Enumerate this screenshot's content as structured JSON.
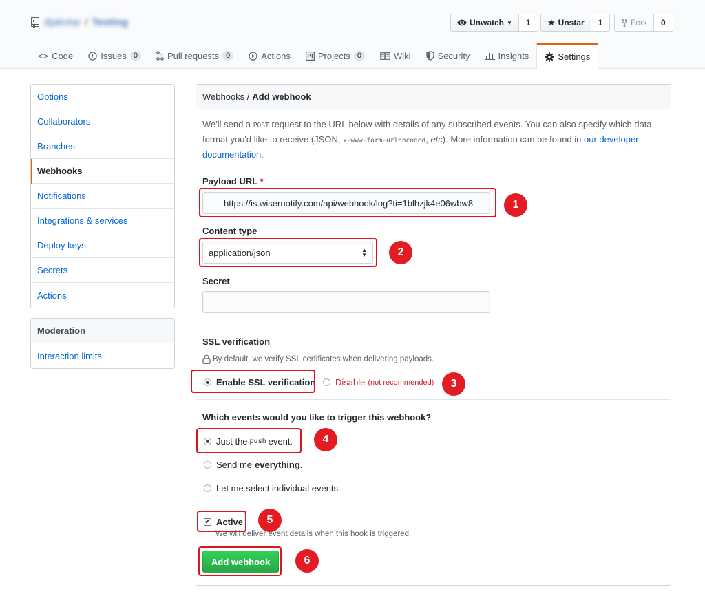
{
  "repo": {
    "owner": "djakotar",
    "name": "Testing",
    "separator": "/"
  },
  "actions": {
    "watch": {
      "label": "Unwatch",
      "count": "1"
    },
    "star": {
      "label": "Unstar",
      "count": "1"
    },
    "fork": {
      "label": "Fork",
      "count": "0"
    }
  },
  "tabs": [
    {
      "label": "Code",
      "icon": "code-icon"
    },
    {
      "label": "Issues",
      "counter": "0",
      "icon": "issue-icon"
    },
    {
      "label": "Pull requests",
      "counter": "0",
      "icon": "pull-request-icon"
    },
    {
      "label": "Actions",
      "icon": "play-icon"
    },
    {
      "label": "Projects",
      "counter": "0",
      "icon": "project-icon"
    },
    {
      "label": "Wiki",
      "icon": "book-icon"
    },
    {
      "label": "Security",
      "icon": "shield-icon"
    },
    {
      "label": "Insights",
      "icon": "graph-icon"
    },
    {
      "label": "Settings",
      "icon": "gear-icon"
    }
  ],
  "sidebar": {
    "items": [
      "Options",
      "Collaborators",
      "Branches",
      "Webhooks",
      "Notifications",
      "Integrations & services",
      "Deploy keys",
      "Secrets",
      "Actions"
    ],
    "selected": "Webhooks",
    "moderation": {
      "heading": "Moderation",
      "items": [
        "Interaction limits"
      ]
    }
  },
  "main": {
    "breadcrumb": {
      "parent": "Webhooks /",
      "current": "Add webhook"
    },
    "intro": {
      "p1": "We'll send a",
      "code1": "POST",
      "p2": "request to the URL below with details of any subscribed events. You can also specify which data format you'd like to receive (JSON,",
      "code2": "x-www-form-urlencoded",
      "p3": ",",
      "etc": "etc",
      "p4": "). More information can be found in",
      "link": "our developer documentation",
      "p5": "."
    },
    "payload_url": {
      "label": "Payload URL",
      "required_mark": "*",
      "value": "https://is.wisernotify.com/api/webhook/log?ti=1blhzjk4e06wbw8"
    },
    "content_type": {
      "label": "Content type",
      "value": "application/json"
    },
    "secret": {
      "label": "Secret",
      "value": ""
    },
    "ssl": {
      "label": "SSL verification",
      "note": "By default, we verify SSL certificates when delivering payloads.",
      "enable": "Enable SSL verification",
      "disable": "Disable",
      "disable_note": "(not recommended)"
    },
    "events": {
      "label": "Which events would you like to trigger this webhook?",
      "opt1_pre": "Just the",
      "opt1_code": "push",
      "opt1_post": "event.",
      "opt2_pre": "Send me",
      "opt2_bold": "everything.",
      "opt3": "Let me select individual events."
    },
    "active": {
      "label": "Active",
      "note": "We will deliver event details when this hook is triggered."
    },
    "submit": "Add webhook"
  },
  "annotations": [
    "1",
    "2",
    "3",
    "4",
    "5",
    "6"
  ],
  "colors": {
    "accent": "#e36209",
    "link": "#0366d6",
    "annotation": "#e31c23",
    "primary": "#28a745"
  }
}
